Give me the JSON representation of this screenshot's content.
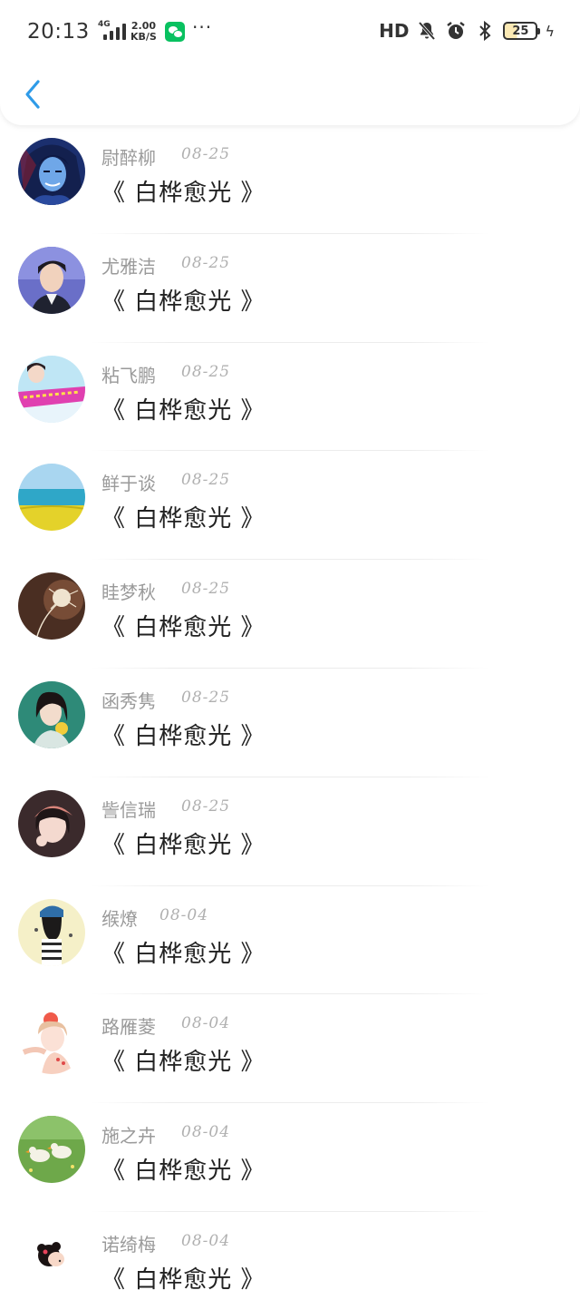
{
  "status_bar": {
    "time": "20:13",
    "network": "4G",
    "speed_value": "2.00",
    "speed_unit": "KB/S",
    "more": "···",
    "hd": "HD",
    "battery": "25"
  },
  "colors": {
    "accent": "#2f9be8",
    "name_text": "#9a9a9a",
    "date_text": "#b0b0b0",
    "title_text": "#222222",
    "wechat_green": "#09c160"
  },
  "comments": [
    {
      "name": "尉醉柳",
      "date": "08-25",
      "title": "《 白桦愈光 》"
    },
    {
      "name": "尤雅洁",
      "date": "08-25",
      "title": "《 白桦愈光 》"
    },
    {
      "name": "粘飞鹏",
      "date": "08-25",
      "title": "《 白桦愈光 》"
    },
    {
      "name": "鲜于谈",
      "date": "08-25",
      "title": "《 白桦愈光 》"
    },
    {
      "name": "眭梦秋",
      "date": "08-25",
      "title": "《 白桦愈光 》"
    },
    {
      "name": "函秀隽",
      "date": "08-25",
      "title": "《 白桦愈光 》"
    },
    {
      "name": "訾信瑞",
      "date": "08-25",
      "title": "《 白桦愈光 》"
    },
    {
      "name": "缑燎",
      "date": "08-04",
      "title": "《 白桦愈光 》"
    },
    {
      "name": "路雁菱",
      "date": "08-04",
      "title": "《 白桦愈光 》"
    },
    {
      "name": "施之卉",
      "date": "08-04",
      "title": "《 白桦愈光 》"
    },
    {
      "name": "诺绮梅",
      "date": "08-04",
      "title": "《 白桦愈光 》"
    }
  ]
}
